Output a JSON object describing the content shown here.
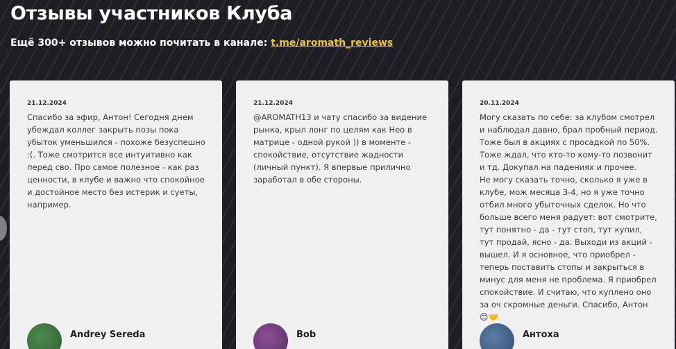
{
  "header": {
    "title": "Отзывы участников Клуба",
    "subtitle": "Ещё 300+ отзывов можно почитать в канале:",
    "link": "t.me/aromath_reviews",
    "link_color": "#f2c23c"
  },
  "reviews": [
    {
      "date": "21.12.2024",
      "text": "Спасибо за эфир, Антон! Сегодня днем убеждал коллег закрыть позы пока убыток уменьшился - похоже безуспешно :(. Тоже смотрится все интуитивно как перед сво. Про самое полезное - как раз ценности, в клубе и важно что спокойное и достойное место без истерик и суеты, например.",
      "author": "Andrey Sereda"
    },
    {
      "date": "21.12.2024",
      "text": "@AROMATH13 и чату спасибо за видение рынка, крыл лонг по целям как Нео в матрице - одной рукой )) в моменте - спокойствие, отсутствие жадности (личный пункт). Я впервые прилично заработал в обе стороны.",
      "author": "Bob"
    },
    {
      "date": "20.11.2024",
      "text": "Могу сказать по себе: за клубом смотрел и наблюдал давно, брал пробный период. Тоже был в акциях с просадкой по 50%. Тоже ждал, что кто-то кому-то позвонит и тд. Докупал на падениях и прочее.\nНе могу сказать точно, сколько я уже в клубе, мож месяца 3-4, но я уже точно отбил много убыточных сделок. Но что больше всего меня радует: вот смотрите, тут понятно - да - тут стоп, тут купил, тут продай, ясно - да. Выходи из акций - вышел. И я основное, что приобрел - теперь поставить стопы и закрыться в минус для меня не проблема. Я приобрел спокойствие. И считаю, что куплено оно за оч скромные деньги. Спасибо, Антон",
      "emoji": "😊🤝",
      "author": "Антоха"
    }
  ]
}
